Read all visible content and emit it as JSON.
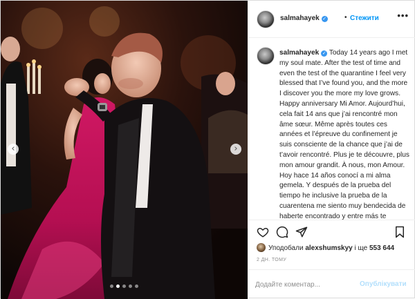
{
  "post": {
    "username": "salmahayek",
    "follow_label": "Стежити",
    "header_separator": "•",
    "more_label": "•••",
    "caption_username": "salmahayek",
    "caption_text": "Today 14 years ago I met my soul mate. After the test of time and even the test of the quarantine I feel very blessed that I’ve found you, and the more I discover you the more my love grows. Happy anniversary Mi Amor. Aujourd’hui, cela fait 14 ans que j’ai rencontré mon âme sœur. Même après toutes ces années et l’épreuve du confinement je suis consciente de la chance que j’ai de t’avoir rencontré. Plus je te découvre, plus mon amour grandit. À nous, mon Amour. Hoy hace 14 años conocí a mi alma gemela. Y después de la prueba del tiempo he inclusive la prueba de la cuarentena me siento muy bendecida de haberte encontrado y entre más te descubro más crece mi amor. Feliz aniversario mi Amor.",
    "likes_prefix": "Уподобали",
    "likes_user": "alexshumskyy",
    "likes_middle": "і ще",
    "likes_count": "553 644",
    "timestamp": "2 ДН. ТОМУ",
    "comment_placeholder": "Додайте коментар...",
    "publish_label": "Опублікувати"
  },
  "carousel": {
    "prev_icon": "‹",
    "next_icon": "›",
    "slides_total": 5,
    "active_index": 1
  },
  "colors": {
    "accent_blue": "#0095f6",
    "verified_blue": "#3897f0",
    "publish_disabled": "#b2dffc",
    "dress_magenta": "#c0135a"
  }
}
